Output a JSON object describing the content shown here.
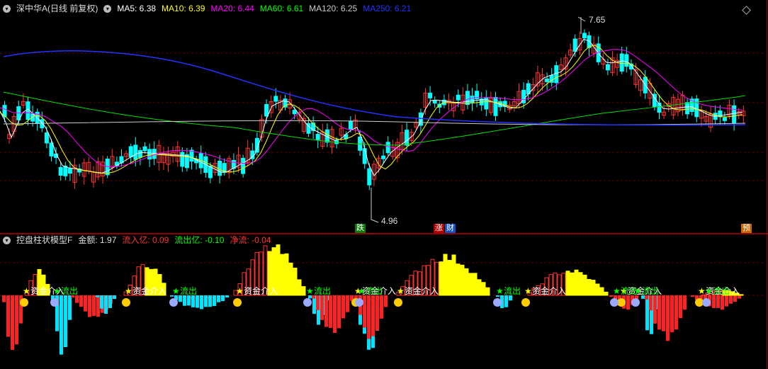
{
  "price_header": {
    "title": "深中华A(日线 前复权)",
    "ma": [
      {
        "label": "MA5: 6.38",
        "color": "#ffffff"
      },
      {
        "label": "MA10: 6.39",
        "color": "#ffff00"
      },
      {
        "label": "MA20: 6.44",
        "color": "#ff00ff"
      },
      {
        "label": "MA60: 6.61",
        "color": "#00ff00"
      },
      {
        "label": "MA120: 6.25",
        "color": "#cccccc"
      },
      {
        "label": "MA250: 6.21",
        "color": "#2233ff"
      }
    ]
  },
  "price_annotations": {
    "high": "7.65",
    "low": "4.96"
  },
  "event_tags": [
    {
      "label": "跌",
      "bg": "#0a7a0a"
    },
    {
      "label": "涨",
      "bg": "#b00000"
    },
    {
      "label": "财",
      "bg": "#1550c0"
    },
    {
      "label": "预",
      "bg": "#cc6600"
    }
  ],
  "indicator_header": {
    "title": "控盘柱状模型F",
    "amount": "金额: 1.97",
    "inflow": "流入亿: 0.09",
    "outflow": "流出亿: -0.10",
    "net": "净流: -0.04"
  },
  "signals": {
    "inflow": "资金介入",
    "outflow": "流出"
  },
  "colors": {
    "up": "#ff3333",
    "down": "#00ffff",
    "bg": "#000000",
    "grid": "#8b0000"
  },
  "chart_data": {
    "type": "candlestick",
    "price_range": [
      4.8,
      7.8
    ],
    "high": 7.65,
    "low": 4.96
  }
}
